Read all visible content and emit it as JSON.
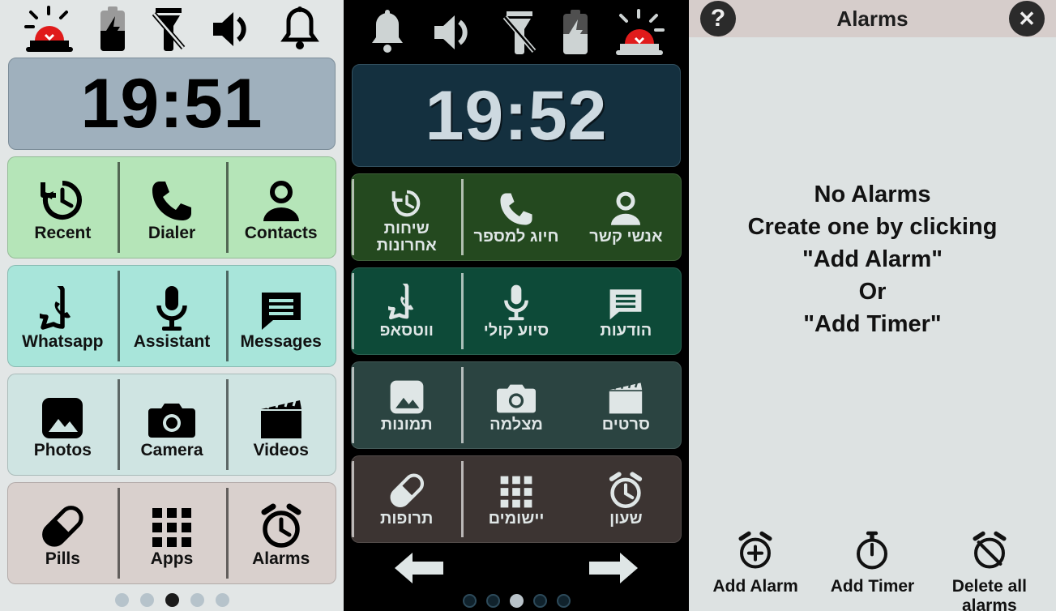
{
  "panels": {
    "launcher_light": {
      "status_icons": [
        "emergency-siren-icon",
        "battery-charging-icon",
        "flashlight-off-icon",
        "volume-on-icon",
        "bell-icon"
      ],
      "clock": "19:51",
      "rows": [
        {
          "color": "#b5e5b8",
          "divider": "#1d5c27",
          "cells": [
            {
              "icon": "history-icon",
              "label": "Recent"
            },
            {
              "icon": "phone-icon",
              "label": "Dialer"
            },
            {
              "icon": "person-icon",
              "label": "Contacts"
            }
          ]
        },
        {
          "color": "#a8e5da",
          "divider": "#11564a",
          "cells": [
            {
              "icon": "whatsapp-icon",
              "label": "Whatsapp"
            },
            {
              "icon": "microphone-icon",
              "label": "Assistant"
            },
            {
              "icon": "message-icon",
              "label": "Messages"
            }
          ]
        },
        {
          "color": "#cfe4e2",
          "divider": "#2b4441",
          "cells": [
            {
              "icon": "photo-icon",
              "label": "Photos"
            },
            {
              "icon": "camera-icon",
              "label": "Camera"
            },
            {
              "icon": "clapperboard-icon",
              "label": "Videos"
            }
          ]
        },
        {
          "color": "#d9d0cd",
          "divider": "#3c3432",
          "cells": [
            {
              "icon": "pill-icon",
              "label": "Pills"
            },
            {
              "icon": "apps-grid-icon",
              "label": "Apps"
            },
            {
              "icon": "alarm-clock-icon",
              "label": "Alarms"
            }
          ]
        }
      ],
      "page_dots": {
        "count": 5,
        "active_index": 2
      }
    },
    "launcher_dark": {
      "status_icons": [
        "bell-icon",
        "volume-on-icon",
        "flashlight-off-icon",
        "battery-charging-icon",
        "emergency-siren-icon"
      ],
      "clock": "19:52",
      "rows": [
        {
          "color": "#24491f",
          "cells": [
            {
              "icon": "person-icon",
              "label": "אנשי קשר"
            },
            {
              "icon": "phone-icon",
              "label": "חיוג למספר"
            },
            {
              "icon": "history-icon",
              "label": "שיחות\nאחרונות"
            }
          ]
        },
        {
          "color": "#0d4a38",
          "cells": [
            {
              "icon": "message-icon",
              "label": "הודעות"
            },
            {
              "icon": "microphone-icon",
              "label": "סיוע קולי"
            },
            {
              "icon": "whatsapp-icon",
              "label": "ווטסאפ"
            }
          ]
        },
        {
          "color": "#2b4441",
          "cells": [
            {
              "icon": "clapperboard-icon",
              "label": "סרטים"
            },
            {
              "icon": "camera-icon",
              "label": "מצלמה"
            },
            {
              "icon": "photo-icon",
              "label": "תמונות"
            }
          ]
        },
        {
          "color": "#3c3432",
          "cells": [
            {
              "icon": "alarm-clock-icon",
              "label": "שעון"
            },
            {
              "icon": "apps-grid-icon",
              "label": "יישומים"
            },
            {
              "icon": "pill-icon",
              "label": "תרופות"
            }
          ]
        }
      ],
      "nav": {
        "prev": "arrow-left-icon",
        "next": "arrow-right-icon"
      },
      "page_dots": {
        "count": 5,
        "active_index": 2
      }
    },
    "alarms_dialog": {
      "header": {
        "help_label": "?",
        "title": "Alarms",
        "close_label": "✕"
      },
      "empty_state": [
        "No Alarms",
        "Create one by clicking",
        "\"Add Alarm\"",
        "Or",
        "\"Add Timer\""
      ],
      "actions": [
        {
          "icon": "alarm-add-icon",
          "label": "Add Alarm"
        },
        {
          "icon": "timer-icon",
          "label": "Add Timer"
        },
        {
          "icon": "alarm-off-icon",
          "label": "Delete all alarms"
        }
      ]
    }
  },
  "colors": {
    "light_bg": "#e2e6e6",
    "dark_bg": "#000000",
    "dialog_bg": "#dde2e2",
    "dialog_header": "#d6cdcb",
    "clock_light": "#9fb0bd",
    "clock_dark": "#14303f",
    "siren_red": "#e01b1b"
  }
}
